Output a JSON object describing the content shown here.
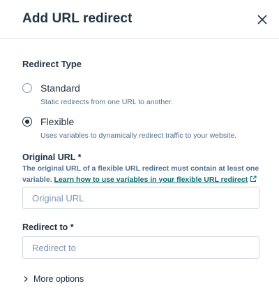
{
  "dialog": {
    "title": "Add URL redirect"
  },
  "redirect_type": {
    "label": "Redirect Type",
    "options": [
      {
        "label": "Standard",
        "help": "Static redirects from one URL to another.",
        "selected": false
      },
      {
        "label": "Flexible",
        "help": "Uses variables to dynamically redirect traffic to your website.",
        "selected": true
      }
    ]
  },
  "original_url": {
    "label": "Original URL *",
    "help_text": "The original URL of a flexible URL redirect must contain at least one variable.",
    "help_link": "Learn how to use variables in your flexible URL redirect",
    "value": "",
    "placeholder": "Original URL"
  },
  "redirect_to": {
    "label": "Redirect to *",
    "value": "",
    "placeholder": "Redirect to"
  },
  "more_options": {
    "label": "More options",
    "icon": "chevron-right-icon"
  },
  "colors": {
    "heading": "#213343",
    "secondary_text": "#516f90",
    "link": "#0b6b72",
    "input_border": "#cbd6e2",
    "divider": "#dfe3eb"
  }
}
